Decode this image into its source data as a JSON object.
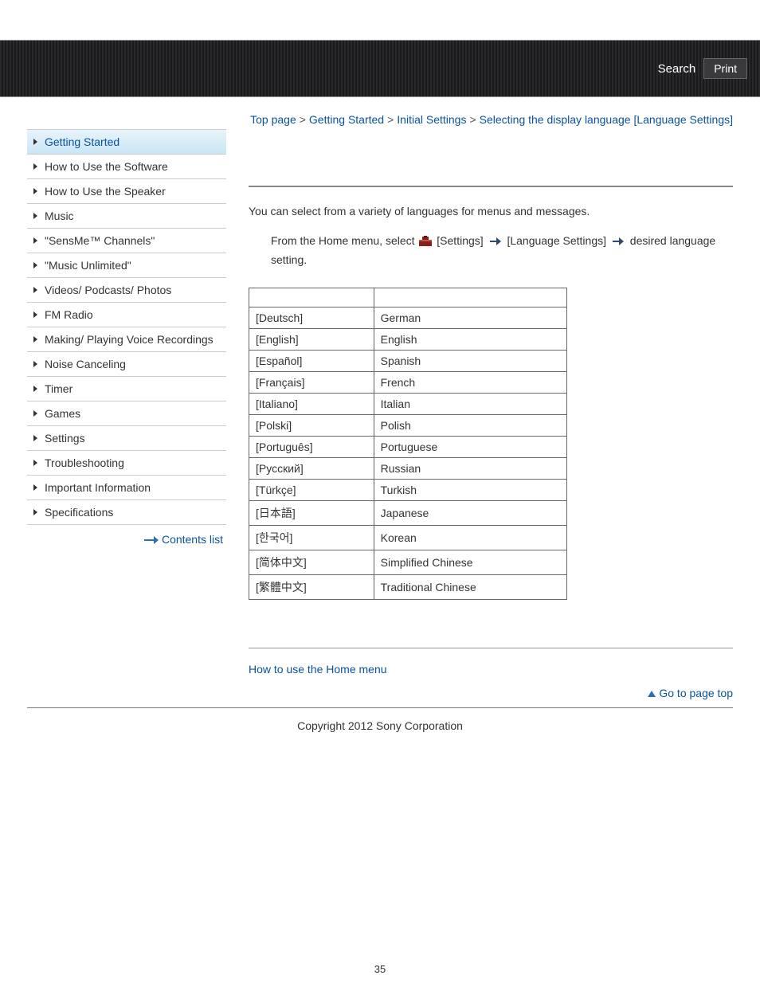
{
  "header": {
    "search_label": "Search",
    "print_label": "Print"
  },
  "sidebar": {
    "items": [
      "Getting Started",
      "How to Use the Software",
      "How to Use the Speaker",
      "Music",
      "\"SensMe™ Channels\"",
      "\"Music Unlimited\"",
      "Videos/ Podcasts/ Photos",
      "FM Radio",
      "Making/ Playing Voice Recordings",
      "Noise Canceling",
      "Timer",
      "Games",
      "Settings",
      "Troubleshooting",
      "Important Information",
      "Specifications"
    ],
    "active_index": 0,
    "contents_list_label": "Contents list"
  },
  "breadcrumb": {
    "top": "Top page",
    "l1": "Getting Started",
    "l2": "Initial Settings",
    "current": "Selecting the display language [Language Settings]"
  },
  "body": {
    "intro": "You can select from a variety of languages for menus and messages.",
    "instr_prefix": "From the Home menu, select ",
    "instr_settings": "[Settings]",
    "instr_lang": "[Language Settings]",
    "instr_suffix": " desired language setting."
  },
  "table": {
    "rows": [
      {
        "code": "[Deutsch]",
        "name": "German"
      },
      {
        "code": "[English]",
        "name": "English"
      },
      {
        "code": "[Español]",
        "name": "Spanish"
      },
      {
        "code": "[Français]",
        "name": "French"
      },
      {
        "code": "[Italiano]",
        "name": "Italian"
      },
      {
        "code": "[Polski]",
        "name": "Polish"
      },
      {
        "code": "[Português]",
        "name": "Portuguese"
      },
      {
        "code": "[Русский]",
        "name": "Russian"
      },
      {
        "code": "[Türkçe]",
        "name": "Turkish"
      },
      {
        "code": "[日本語]",
        "name": "Japanese"
      },
      {
        "code": "[한국어]",
        "name": "Korean"
      },
      {
        "code": "[简体中文]",
        "name": "Simplified Chinese"
      },
      {
        "code": "[繁體中文]",
        "name": "Traditional Chinese"
      }
    ]
  },
  "related": {
    "link_label": "How to use the Home menu"
  },
  "footer": {
    "go_top_label": "Go to page top",
    "copyright": "Copyright 2012 Sony Corporation",
    "page_number": "35"
  }
}
